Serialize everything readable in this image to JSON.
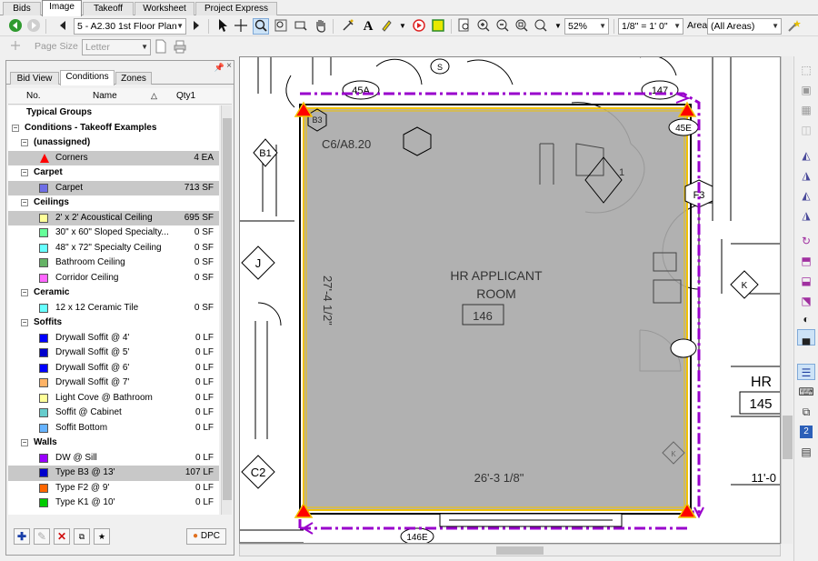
{
  "tabs": [
    "Bids",
    "Image",
    "Takeoff",
    "Worksheet",
    "Project Express"
  ],
  "active_tab": "Image",
  "toolbar": {
    "page_select": "5 - A2.30 1st Floor Plan",
    "zoom": "52%",
    "scale": "1/8\" = 1' 0\"",
    "area_label": "Area",
    "area_select": "(All Areas)",
    "page_size_label": "Page Size",
    "page_size_value": "Letter"
  },
  "panel": {
    "tabs": [
      "Bid View",
      "Conditions",
      "Zones"
    ],
    "active_tab": "Conditions",
    "columns": {
      "no": "No.",
      "name": "Name",
      "qty": "Qty1"
    },
    "rows": [
      {
        "type": "group",
        "level": 0,
        "name": "Typical Groups"
      },
      {
        "type": "group",
        "level": 0,
        "expander": "−",
        "name": "Conditions - Takeoff Examples"
      },
      {
        "type": "group",
        "level": 1,
        "expander": "−",
        "name": "(unassigned)"
      },
      {
        "type": "item",
        "swatch": "#ff0000",
        "shape": "triangle",
        "name": "Corners",
        "qty": "4 EA",
        "selected": true
      },
      {
        "type": "group",
        "level": 1,
        "expander": "−",
        "name": "Carpet"
      },
      {
        "type": "item",
        "swatch": "#6e6ee6",
        "name": "Carpet",
        "qty": "713 SF",
        "selected": true
      },
      {
        "type": "group",
        "level": 1,
        "expander": "−",
        "name": "Ceilings"
      },
      {
        "type": "item",
        "swatch": "#ffff99",
        "name": "2' x 2' Acoustical Ceiling",
        "qty": "695 SF",
        "selected": true
      },
      {
        "type": "item",
        "swatch": "#66ff99",
        "name": "30\" x 60\" Sloped Specialty...",
        "qty": "0 SF"
      },
      {
        "type": "item",
        "swatch": "#66ffff",
        "name": "48\" x 72\" Specialty Ceiling",
        "qty": "0 SF"
      },
      {
        "type": "item",
        "swatch": "#66b366",
        "name": "Bathroom Ceiling",
        "qty": "0 SF"
      },
      {
        "type": "item",
        "swatch": "#ff66ff",
        "name": "Corridor Ceiling",
        "qty": "0 SF"
      },
      {
        "type": "group",
        "level": 1,
        "expander": "−",
        "name": "Ceramic"
      },
      {
        "type": "item",
        "swatch": "#66ffff",
        "name": "12 x 12 Ceramic Tile",
        "qty": "0 SF"
      },
      {
        "type": "group",
        "level": 1,
        "expander": "−",
        "name": "Soffits"
      },
      {
        "type": "item",
        "swatch": "#0000ff",
        "name": "Drywall Soffit @ 4'",
        "qty": "0 LF"
      },
      {
        "type": "item",
        "swatch": "#0000cc",
        "name": "Drywall Soffit @ 5'",
        "qty": "0 LF"
      },
      {
        "type": "item",
        "swatch": "#0000ff",
        "name": "Drywall Soffit @ 6'",
        "qty": "0 LF"
      },
      {
        "type": "item",
        "swatch": "#ffb366",
        "name": "Drywall Soffit @ 7'",
        "qty": "0 LF"
      },
      {
        "type": "item",
        "swatch": "#ffff99",
        "name": "Light Cove @ Bathroom",
        "qty": "0 LF"
      },
      {
        "type": "item",
        "swatch": "#66cccc",
        "name": "Soffit @ Cabinet",
        "qty": "0 LF"
      },
      {
        "type": "item",
        "swatch": "#66b3ff",
        "name": "Soffit Bottom",
        "qty": "0 LF"
      },
      {
        "type": "group",
        "level": 1,
        "expander": "−",
        "name": "Walls"
      },
      {
        "type": "item",
        "swatch": "#9900ff",
        "name": "DW @ Sill",
        "qty": "0 LF"
      },
      {
        "type": "item",
        "swatch": "#0000cc",
        "name": "Type B3 @ 13'",
        "qty": "107 LF",
        "selected": true
      },
      {
        "type": "item",
        "swatch": "#ff6600",
        "name": "Type F2 @ 9'",
        "qty": "0 LF"
      },
      {
        "type": "item",
        "swatch": "#00cc00",
        "name": "Type K1 @ 10'",
        "qty": "0 LF"
      }
    ],
    "dpc_label": "DPC"
  },
  "drawing": {
    "room_name_line1": "HR APPLICANT",
    "room_name_line2": "ROOM",
    "room_number": "146",
    "dim_horizontal": "26'-3 1/8\"",
    "dim_vertical": "27'-4 1/2\"",
    "dim_right": "11'-0",
    "ref_c6": "C6/A8.20",
    "tag_b1": "B1",
    "tag_j": "J",
    "tag_c2": "C2",
    "tag_k": "K",
    "tag_k2": "K",
    "tag_f3": "F3",
    "tag_1": "1",
    "tag_b3": "B3",
    "tag_45a": "45A",
    "tag_147": "147",
    "tag_45e": "45E",
    "tag_145": "145",
    "tag_146e": "146E",
    "tag_s": "S",
    "hr_label": "HR",
    "hr_number": "145",
    "colors": {
      "room_fill": "#a9a9a9",
      "outline_yellow": "#f2c200",
      "dash_purple": "#9900cc",
      "corner_red": "#ff0000"
    }
  }
}
